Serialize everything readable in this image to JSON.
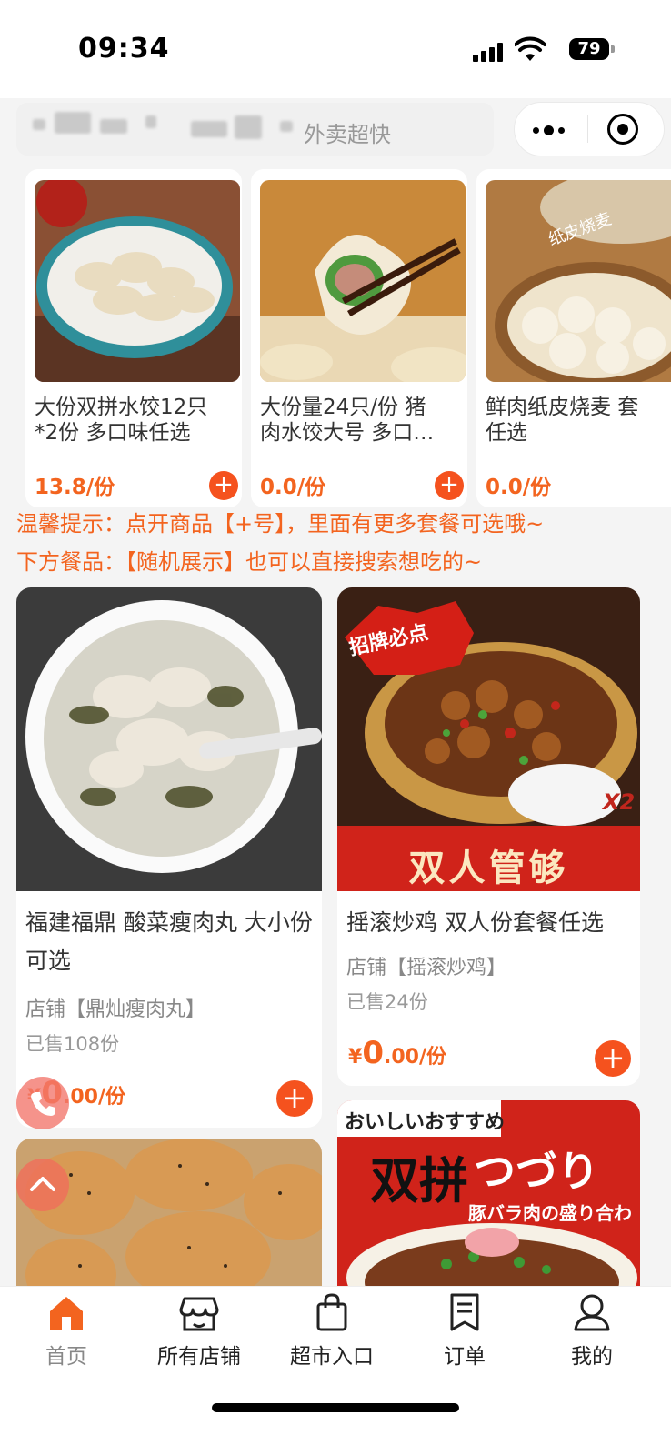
{
  "status_bar": {
    "time": "09:34",
    "battery": "79"
  },
  "search": {
    "hint": "外卖超快"
  },
  "horizontal_products": [
    {
      "name": "大份双拼水饺12只\n*2份 多口味任选",
      "price": "13.8/份",
      "image": "dumpling-bowl"
    },
    {
      "name": "大份量24只/份 猪\n肉水饺大号 多口…",
      "price": "0.0/份",
      "image": "dumpling-chopsticks"
    },
    {
      "name": "鲜肉纸皮烧麦 套\n任选",
      "price": "0.0/份",
      "image": "shaomai",
      "image_label": "纸皮烧麦"
    }
  ],
  "tips": {
    "line1": "温馨提示：点开商品【+号】，里面有更多套餐可选哦~",
    "line2": "下方餐品：【随机展示】也可以直接搜索想吃的~"
  },
  "products": [
    {
      "name": "福建福鼎 酸菜瘦肉丸 大小份可选",
      "shop": "店铺【鼎灿瘦肉丸】",
      "sold": "已售108份",
      "price_currency": "¥",
      "price_int": "0",
      "price_dec": ".00/份",
      "image": "meatball-soup"
    },
    {
      "name": "摇滚炒鸡 双人份套餐任选",
      "shop": "店铺【摇滚炒鸡】",
      "sold": "已售24份",
      "price_currency": "¥",
      "price_int": "0",
      "price_dec": ".00/份",
      "image": "fried-chicken",
      "badge": "招牌必点",
      "banner": "双人管够",
      "tag": "X2"
    },
    {
      "image": "cakes"
    },
    {
      "image": "pork-rice",
      "banner_top": "おいしいおすすめ",
      "banner_main": "双拼",
      "banner_jp": "つづり",
      "banner_sub": "豚バラ肉の盛り合わ"
    }
  ],
  "tabs": [
    {
      "label": "首页",
      "icon": "home-icon",
      "active": true
    },
    {
      "label": "所有店铺",
      "icon": "shop-icon"
    },
    {
      "label": "超市入口",
      "icon": "shopping-bag-icon"
    },
    {
      "label": "订单",
      "icon": "order-icon"
    },
    {
      "label": "我的",
      "icon": "user-icon"
    }
  ],
  "colors": {
    "accent": "#f3641f",
    "plus": "#f5521e",
    "home_icon": "#f3641f"
  }
}
